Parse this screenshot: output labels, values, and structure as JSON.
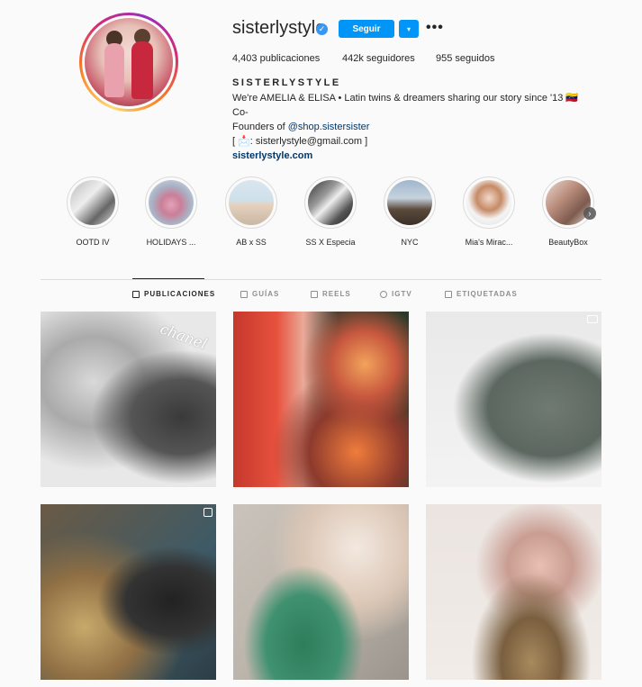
{
  "profile": {
    "username": "sisterlystyle",
    "verified_icon": "verified-badge-icon",
    "follow_label": "Seguir",
    "dropdown_icon": "▾",
    "more_icon": "•••",
    "posts": "4,403 publicaciones",
    "followers": "442k seguidores",
    "following": "955 seguidos",
    "full_name": "SISTERLYSTYLE",
    "bio_line1": "We're AMELIA & ELISA • Latin twins & dreamers sharing our story since '13 🇻🇪 Co-",
    "bio_line2_prefix": "Founders of ",
    "bio_mention": "@shop.sistersister",
    "bio_line3": "[ 📩: sisterlystyle@gmail.com ]",
    "website": "sisterlystyle.com"
  },
  "highlights": [
    {
      "label": "OOTD IV"
    },
    {
      "label": "HOLIDAYS ..."
    },
    {
      "label": "AB x SS"
    },
    {
      "label": "SS X Especia"
    },
    {
      "label": "NYC"
    },
    {
      "label": "Mia's Mirac..."
    },
    {
      "label": "BeautyBox"
    }
  ],
  "tabs": [
    {
      "label": "PUBLICACIONES"
    },
    {
      "label": "GUÍAS"
    },
    {
      "label": "REELS"
    },
    {
      "label": "IGTV"
    },
    {
      "label": "ETIQUETADAS"
    }
  ],
  "colors": {
    "accent": "#0095f6",
    "text": "#262626",
    "muted": "#8e8e8e",
    "link": "#00376b",
    "background": "#fafafa"
  }
}
